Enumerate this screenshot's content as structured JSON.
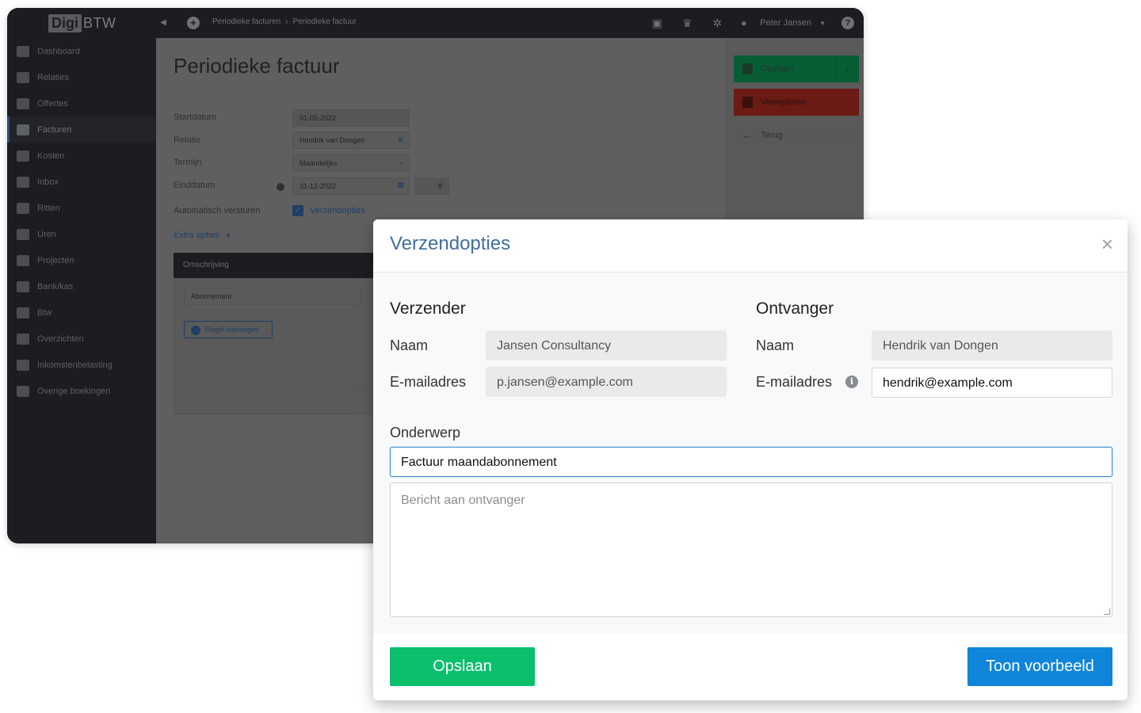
{
  "app": {
    "logo_box": "Digi",
    "logo_text": "BTW",
    "breadcrumb": [
      "Periodieke facturen",
      "Periodieke factuur"
    ],
    "user_name": "Peter Jansen"
  },
  "sidebar": {
    "items": [
      {
        "label": "Dashboard",
        "icon": "dashboard-icon"
      },
      {
        "label": "Relaties",
        "icon": "users-icon"
      },
      {
        "label": "Offertes",
        "icon": "document-icon"
      },
      {
        "label": "Facturen",
        "icon": "invoice-icon",
        "active": true
      },
      {
        "label": "Kosten",
        "icon": "money-icon"
      },
      {
        "label": "Inbox",
        "icon": "inbox-icon"
      },
      {
        "label": "Ritten",
        "icon": "car-icon"
      },
      {
        "label": "Uren",
        "icon": "clock-icon"
      },
      {
        "label": "Projecten",
        "icon": "folder-icon"
      },
      {
        "label": "Bank/kas",
        "icon": "card-icon"
      },
      {
        "label": "Btw",
        "icon": "calculator-icon"
      },
      {
        "label": "Overzichten",
        "icon": "chart-icon"
      },
      {
        "label": "Inkomstenbelasting",
        "icon": "clipboard-icon"
      },
      {
        "label": "Overige boekingen",
        "icon": "circle-x-icon"
      }
    ]
  },
  "form": {
    "title": "Periodieke factuur",
    "startdatum_label": "Startdatum",
    "startdatum_value": "01-05-2022",
    "relatie_label": "Relatie",
    "relatie_value": "Hendrik van Dongen",
    "termijn_label": "Termijn",
    "termijn_value": "Maandelijks",
    "einddatum_label": "Einddatum",
    "einddatum_value": "31-12-2022",
    "einddatum_count": "8",
    "auto_label": "Automatisch versturen",
    "verzendopties_link": "Verzendopties",
    "extra_opties": "Extra opties",
    "table_header": "Omschrijving",
    "row_value": "Abonnement",
    "add_row": "Regel toevoegen"
  },
  "actions": {
    "save": "Opslaan",
    "delete": "Verwijderen",
    "back": "Terug"
  },
  "modal": {
    "title": "Verzendopties",
    "sender_title": "Verzender",
    "receiver_title": "Ontvanger",
    "name_label": "Naam",
    "email_label": "E-mailadres",
    "sender_name": "Jansen Consultancy",
    "sender_email": "p.jansen@example.com",
    "receiver_name": "Hendrik van Dongen",
    "receiver_email": "hendrik@example.com",
    "subject_label": "Onderwerp",
    "subject_value": "Factuur maandabonnement",
    "message_placeholder": "Bericht aan ontvanger",
    "save_button": "Opslaan",
    "preview_button": "Toon voorbeeld"
  },
  "colors": {
    "green": "#0bbf6d",
    "blue": "#0f86d9",
    "title_blue": "#3f6fa0"
  }
}
